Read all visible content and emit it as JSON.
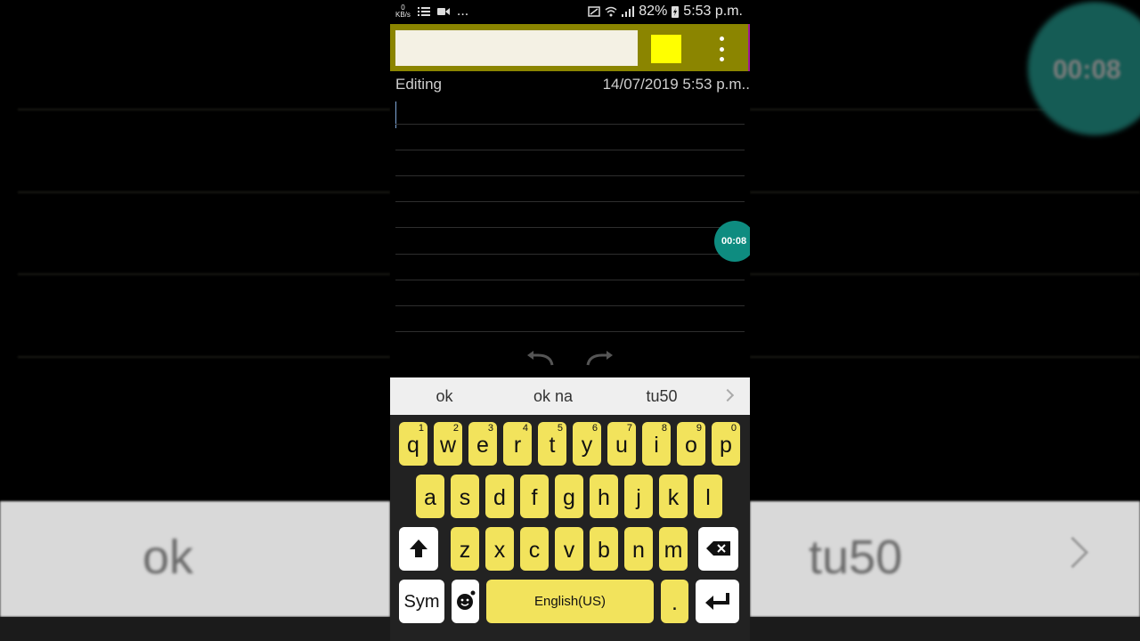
{
  "status_bar": {
    "speed_value": "0",
    "speed_unit": "KB/s",
    "overflow": "...",
    "battery": "82%",
    "time": "5:53 p.m."
  },
  "note": {
    "mode": "Editing",
    "timestamp": "14/07/2019 5:53 p.m..",
    "swatch_color": "#ffff00",
    "toolbar_color": "#8b8500"
  },
  "timer": {
    "label": "00:08"
  },
  "suggestions": [
    "ok",
    "ok na",
    "tu50"
  ],
  "keyboard": {
    "row1": [
      {
        "letter": "q",
        "num": "1"
      },
      {
        "letter": "w",
        "num": "2"
      },
      {
        "letter": "e",
        "num": "3"
      },
      {
        "letter": "r",
        "num": "4"
      },
      {
        "letter": "t",
        "num": "5"
      },
      {
        "letter": "y",
        "num": "6"
      },
      {
        "letter": "u",
        "num": "7"
      },
      {
        "letter": "i",
        "num": "8"
      },
      {
        "letter": "o",
        "num": "9"
      },
      {
        "letter": "p",
        "num": "0"
      }
    ],
    "row2": [
      "a",
      "s",
      "d",
      "f",
      "g",
      "h",
      "j",
      "k",
      "l"
    ],
    "row3": [
      "z",
      "x",
      "c",
      "v",
      "b",
      "n",
      "m"
    ],
    "sym_label": "Sym",
    "space_label": "English(US)",
    "period_label": "."
  },
  "background": {
    "left_word": "ok",
    "right_word": "tu50",
    "bubble_text": "00:08"
  }
}
